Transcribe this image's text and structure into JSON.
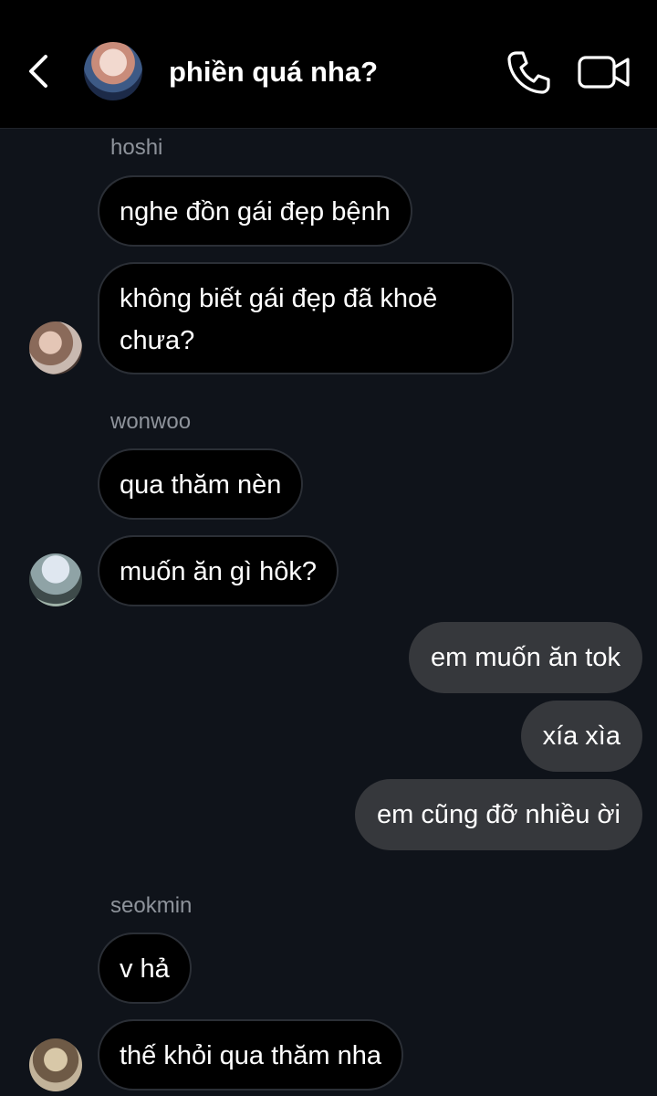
{
  "header": {
    "title": "phiền quá nha?"
  },
  "messages": [
    {
      "sender": "hoshi",
      "texts": [
        "nghe đồn gái đẹp bệnh",
        "không biết gái đẹp đã khoẻ chưa?"
      ]
    },
    {
      "sender": "wonwoo",
      "texts": [
        "qua thăm nèn",
        "muốn ăn gì hôk?"
      ]
    },
    {
      "sender": "me",
      "texts": [
        "em muốn ăn tok",
        "xía xìa",
        "em cũng đỡ nhiều ời"
      ]
    },
    {
      "sender": "seokmin",
      "texts": [
        "v hả",
        "thế khỏi qua thăm nha"
      ]
    }
  ],
  "icons": {
    "back": "chevron-left-icon",
    "call": "phone-icon",
    "video": "video-camera-icon"
  },
  "colors": {
    "background": "#0f131a",
    "header": "#000000",
    "incoming_bubble": "#000000",
    "outgoing_bubble": "#36383c",
    "sender_name": "#8e939b"
  }
}
